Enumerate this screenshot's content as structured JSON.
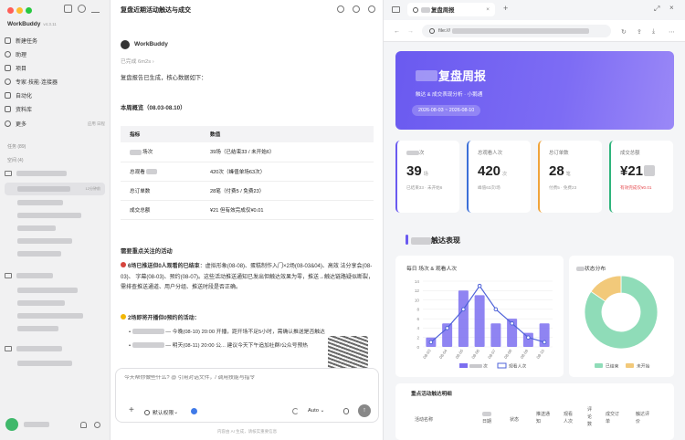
{
  "sidebar": {
    "app_name": "WorkBuddy",
    "version": "v4.3.11",
    "nav": [
      {
        "label": "新建任务",
        "icon": "new-task-icon"
      },
      {
        "label": "助理",
        "icon": "assistant-icon"
      },
      {
        "label": "项目",
        "icon": "project-icon"
      },
      {
        "label": "专家·技能·连接器",
        "icon": "expert-icon"
      },
      {
        "label": "自动化",
        "icon": "automation-icon"
      },
      {
        "label": "资料库",
        "icon": "library-icon"
      },
      {
        "label": "更多",
        "icon": "more-icon"
      }
    ],
    "more_hint": "应用 日程",
    "tasks_label": "任务 (89)",
    "workspace_label": "空间 (4)",
    "selected_time": "12分钟前"
  },
  "chat": {
    "title": "复盘近期活动触达与成交",
    "agent_name": "WorkBuddy",
    "status": "已完成 6m2s",
    "intro": "复盘报告已生成，核心数据如下：",
    "overview_title": "本周概览（08.03-08.10）",
    "table": {
      "headers": [
        "指标",
        "数值"
      ],
      "rows": [
        [
          "场次",
          "39场（已结束33 / 未开始6）"
        ],
        [
          "总观看",
          "420次（峰值单场63次）"
        ],
        [
          "总订单数",
          "28笔（付费5 / 免费23）"
        ],
        [
          "成交总额",
          "¥21 但有效完成仅¥0.01"
        ]
      ]
    },
    "attention_title": "需要重点关注的活动",
    "item1_bold": "6场已推送但0人观看的已结束",
    "item1_rest": "：虚拟形象(08-08)、蛋糕制作入门×2场(08-03&04)、高效 法分享会(08-03)、 字幕(08-03)、预约(08-07)。这些活动推送通知已发出但触达效果为零，推送→触达链路疑似断裂，需排查推送通道、用户分组、推送时段是否正确。",
    "item2_bold": "2场即将开播但0预约的活动：",
    "bullet1": "— 今晚(08-10) 20:00 开播，距开场不足5小时，需确认推送是否触达",
    "bullet2": "— 明天(08-11) 20:00 公... 建议今天下午追加社群/公众号预热",
    "input_placeholder": "今天帮你做些什么? @ 引用对话文件，/ 调用技能与指令",
    "perm_label": "默认权限",
    "model_label": "Auto",
    "footer": "内容由 AI 生成，请核实重要信息"
  },
  "browser": {
    "tab_title": "复盘周报",
    "url": "file:///",
    "hero": {
      "title": "复盘周报",
      "subtitle": "触达 & 成交表现分析 · 小鹅通",
      "date": "2026-08-03 ~ 2026-08-10"
    },
    "kpis": [
      {
        "label": "次",
        "value": "39",
        "unit": "场",
        "note": "已结束33 · 未开始6",
        "color": "#6a5af0"
      },
      {
        "label": "总观看人次",
        "value": "420",
        "unit": "次",
        "note": "峰值63次/场",
        "color": "#3b6fd8"
      },
      {
        "label": "总订单数",
        "value": "28",
        "unit": "笔",
        "note": "付费5 · 免费23",
        "color": "#f0a43a"
      },
      {
        "label": "成交总额",
        "value": "¥21",
        "unit": "",
        "note": "有效完成仅¥0.01",
        "color": "#2fb47c",
        "note_color": "#e5484d"
      }
    ],
    "section_title": "触达表现",
    "bar_chart_title": "每日 场次 & 观看人次",
    "donut_title": "状态分布",
    "table_title": "重点活动触达明细",
    "table_headers": [
      "活动名称",
      "日期",
      "状态",
      "推送通知",
      "观看人次",
      "评论数",
      "成交订单",
      "触达评价"
    ]
  },
  "chart_data": [
    {
      "type": "bar",
      "title": "每日 场次 & 观看人次",
      "categories": [
        "08-03",
        "08-04",
        "08-05",
        "08-06",
        "08-07",
        "08-08",
        "08-09",
        "08-10"
      ],
      "ylim": [
        0,
        14
      ],
      "y_ticks": [
        0,
        2,
        4,
        6,
        8,
        10,
        12,
        14
      ],
      "series": [
        {
          "name": "次",
          "type": "bar",
          "color": "#7b6ef0",
          "values": [
            2,
            5,
            12,
            11,
            5,
            6,
            3,
            5
          ]
        },
        {
          "name": "观看人次",
          "type": "line",
          "color": "#4f63d8",
          "values": [
            1,
            4,
            8,
            13,
            8,
            5,
            2,
            1
          ]
        }
      ]
    },
    {
      "type": "pie",
      "title": "状态分布",
      "labels": [
        "已结束",
        "未开始"
      ],
      "values": [
        33,
        6
      ],
      "colors": [
        "#8fdcb8",
        "#f2c97a"
      ]
    }
  ]
}
